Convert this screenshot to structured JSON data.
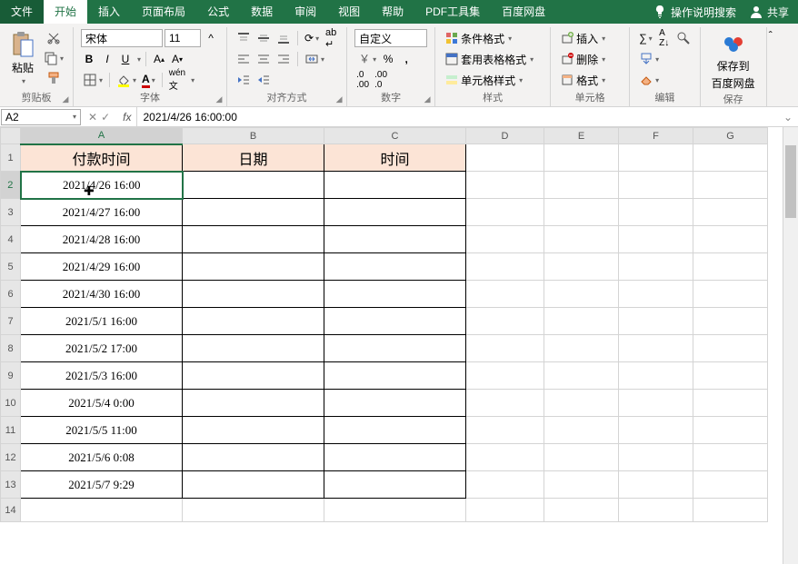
{
  "tabs": {
    "file": "文件",
    "home": "开始",
    "insert": "插入",
    "pagelayout": "页面布局",
    "formula": "公式",
    "data": "数据",
    "review": "审阅",
    "view": "视图",
    "help": "帮助",
    "pdf": "PDF工具集",
    "baidu": "百度网盘",
    "tellme": "操作说明搜索",
    "share": "共享"
  },
  "groups": {
    "clipboard": "剪贴板",
    "font": "字体",
    "align": "对齐方式",
    "number": "数字",
    "styles": "样式",
    "cells": "单元格",
    "editing": "编辑",
    "save": "保存"
  },
  "ribbon": {
    "paste": "粘贴",
    "fontname": "宋体",
    "fontsize": "11",
    "bold": "B",
    "italic": "I",
    "underline": "U",
    "numberformat": "自定义",
    "condformat": "条件格式",
    "tableformat": "套用表格格式",
    "cellstyles": "单元格样式",
    "insert": "插入",
    "delete": "删除",
    "format": "格式",
    "savebaidu": "保存到",
    "savebaidu2": "百度网盘"
  },
  "namebox": "A2",
  "formulabar": "2021/4/26 16:00:00",
  "cols": [
    "A",
    "B",
    "C",
    "D",
    "E",
    "F",
    "G"
  ],
  "headers": {
    "A": "付款时间",
    "B": "日期",
    "C": "时间"
  },
  "rows": [
    "2021/4/26 16:00",
    "2021/4/27 16:00",
    "2021/4/28 16:00",
    "2021/4/29 16:00",
    "2021/4/30 16:00",
    "2021/5/1 16:00",
    "2021/5/2 17:00",
    "2021/5/3 16:00",
    "2021/5/4 0:00",
    "2021/5/5 11:00",
    "2021/5/6 0:08",
    "2021/5/7 9:29"
  ]
}
